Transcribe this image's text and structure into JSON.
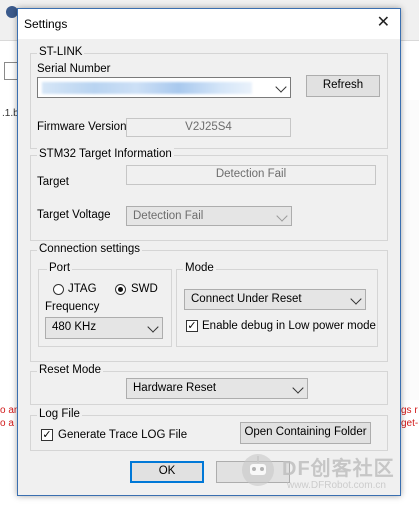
{
  "dialog": {
    "title": "Settings",
    "close_glyph": "✕",
    "close_icon": "close-icon"
  },
  "stlink": {
    "legend": "ST-LINK",
    "serial_label": "Serial Number",
    "refresh_label": "Refresh",
    "firmware_label": "Firmware Version",
    "firmware_value": "V2J25S4"
  },
  "target": {
    "legend": "STM32 Target Information",
    "target_label": "Target",
    "target_value": "Detection Fail",
    "voltage_label": "Target Voltage",
    "voltage_value": "Detection Fail"
  },
  "connection": {
    "legend": "Connection settings",
    "port_legend": "Port",
    "jtag_label": "JTAG",
    "swd_label": "SWD",
    "selected_port": "SWD",
    "frequency_label": "Frequency",
    "frequency_value": "480 KHz",
    "mode_legend": "Mode",
    "mode_value": "Connect Under Reset",
    "debug_low_power_label": "Enable debug in Low power mode",
    "debug_low_power_checked": true
  },
  "reset": {
    "legend": "Reset Mode",
    "value": "Hardware Reset"
  },
  "logfile": {
    "legend": "Log File",
    "trace_label": "Generate Trace LOG File",
    "trace_checked": true,
    "open_folder_label": "Open Containing Folder"
  },
  "footer": {
    "ok_label": "OK"
  },
  "background": {
    "row_text": ".1.b",
    "left_red_1": "o an",
    "left_red_2": "o a l",
    "right_red_1": "gs r",
    "right_red_2": "get-"
  },
  "watermark": {
    "title": "DF创客社区",
    "url": "www.DFRobot.com.cn"
  },
  "colors": {
    "dialog_border": "#3a6fb0",
    "default_button_border": "#0078d7",
    "error_text": "#d11a1a"
  }
}
